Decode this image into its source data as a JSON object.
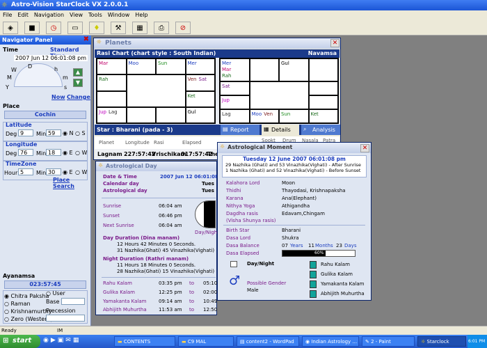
{
  "app": {
    "title": "Astro-Vision StarClock VX 2.0.0.1"
  },
  "menu": [
    "File",
    "Edit",
    "Navigation",
    "View",
    "Tools",
    "Window",
    "Help"
  ],
  "toolbar": [
    "open-icon",
    "save-icon",
    "clock-icon",
    "car-icon",
    "bulb-icon",
    "hammer-icon",
    "map-icon",
    "printer-icon",
    "help-icon"
  ],
  "nav": {
    "title": "Navigator Panel",
    "time_label": "Time",
    "time_mode": "Standard Time",
    "datetime": "2007 Jun 12 06:01:08 pm",
    "dial": {
      "w": "W",
      "d": "D",
      "h": "h",
      "m": "M",
      "mm": "m",
      "y": "Y",
      "s": "s"
    },
    "now": "Now",
    "change": "Change",
    "place_label": "Place",
    "place": "Cochin",
    "latitude_label": "Latitude",
    "lat_deg_label": "Deg",
    "lat_deg": "9",
    "lat_min_label": "Min",
    "lat_min": "59",
    "lat_n": "N",
    "lat_s": "S",
    "longitude_label": "Longitude",
    "lon_deg_label": "Deg",
    "lon_deg": "76",
    "lon_min_label": "Min",
    "lon_min": "18",
    "lon_e": "E",
    "lon_w": "W",
    "timezone_label": "TimeZone",
    "tz_hour_label": "Hour",
    "tz_hour": "5",
    "tz_min_label": "Min",
    "tz_min": "30",
    "tz_e": "E",
    "tz_w": "W",
    "place_search": "Place Search",
    "ayanamsa_label": "Ayanamsa",
    "ayanamsa": "023:57:45",
    "ayanamsa_options": [
      "Chitra Paksha",
      "Raman",
      "Krishnamurthy",
      "Zero (Western)"
    ],
    "user": "User",
    "base": "Base",
    "precession": "Precession"
  },
  "planets": {
    "title": "Planets",
    "rasi_title": "Rasi Chart (chart style : South Indian)",
    "navamsa": "Navamsa",
    "rasi_cells": {
      "c1": [
        "Mar"
      ],
      "c2": [
        "Moo"
      ],
      "c3": [
        "Sun"
      ],
      "c4": [
        "Mer"
      ],
      "c5": [
        "Rah"
      ],
      "c8": [
        "Ven",
        "Sat"
      ],
      "c12": [
        "Ket"
      ],
      "c13": [
        "Jup",
        "Lag"
      ],
      "c16": [
        "Gul"
      ]
    },
    "nav_cells": {
      "c1": [
        "Mer",
        "Mar",
        "Rah"
      ],
      "c3": [
        "Gul"
      ],
      "c5": [
        "Sat"
      ],
      "c9": [
        "Jup"
      ],
      "c13": [
        "Lag"
      ],
      "c14": [
        "Moo",
        "Ven"
      ],
      "c15": [
        "Sun"
      ],
      "c16": [
        "Ket"
      ]
    },
    "star": "Star : Bharani (pada - 3)",
    "tabs": [
      "Report",
      "Details",
      "Analysis"
    ],
    "cols": [
      "Planet",
      "Longitude",
      "Rasi",
      "Elapsed"
    ],
    "row": [
      "Lagnam",
      "227:57:42",
      "Vrischikam",
      "017:57:42",
      "The"
    ],
    "hidden_cols": [
      "Sookt",
      "Drum",
      "Nasala",
      "Patra"
    ]
  },
  "astro_day": {
    "title": "Astrological Day",
    "date_time_label": "Date & Time",
    "date_time": "2007 Jun 12 06:01:08",
    "calendar_label": "Calendar day",
    "calendar": "Tues",
    "astro_label": "Astrological day",
    "astro": "Tues",
    "sunrise_label": "Sunrise",
    "sunrise": "06:04 am",
    "sunset_label": "Sunset",
    "sunset": "06:46 pm",
    "next_sunrise_label": "Next Sunrise",
    "next_sunrise": "06:04 am",
    "daynight": "Day/Nigh",
    "day_dur_label": "Day Duration (Dina manam)",
    "day_dur_1": "12 Hours  42 Minutes  0 Seconds.",
    "day_dur_2": "31 Nazhika(Ghati) 45 Vinazhika(Vighati)",
    "night_dur_label": "Night Duration (Rathri manam)",
    "night_dur_1": "11 Hours  18 Minutes  0 Seconds.",
    "night_dur_2": "28 Nazhika(Ghati) 15 Vinazhika(Vighati)",
    "to": "to",
    "kalams": [
      {
        "name": "Rahu Kalam",
        "from": "03:35 pm",
        "to": "05:10"
      },
      {
        "name": "Gulika Kalam",
        "from": "12:25 pm",
        "to": "02:00"
      },
      {
        "name": "Yamakanta Kalam",
        "from": "09:14 am",
        "to": "10:49"
      },
      {
        "name": "Abhijith Muhurtha",
        "from": "11:53 am",
        "to": "12:50"
      }
    ]
  },
  "moment": {
    "title": "Astrological Moment",
    "date": "Tuesday 12 June 2007   06:01:08 pm",
    "line1": "29 Nazhika (Ghati) and 53 Vinazhika(Vighati) - After Sunrise",
    "line2": "1 Nazhika (Ghati) and 52 Vinazhika(Vighati) - Before Sunset",
    "rows": [
      {
        "label": "Kalahora Lord",
        "value": "Moon"
      },
      {
        "label": "Thidhi",
        "value": "Thayodasi, Krishnapaksha"
      },
      {
        "label": "Karana",
        "value": "Ana(Elephant)"
      },
      {
        "label": "Nithya Yoga",
        "value": "Athigandha"
      },
      {
        "label": "Dagdha rasis",
        "value": "Edavam,Chingam"
      }
    ],
    "dagdha_sub": "(Visha Shunya rasis)",
    "birth_star_label": "Birth Star",
    "birth_star": "Bharani",
    "dasa_lord_label": "Dasa Lord",
    "dasa_lord": "Shukra",
    "dasa_balance_label": "Dasa Balance",
    "years": "07",
    "years_label": "Years",
    "months": "11",
    "months_label": "Months",
    "days": "23",
    "days_label": "Days",
    "dasa_elapsed_label": "Dasa Elapsed",
    "dasa_elapsed": "60%",
    "dasa_elapsed_value": 60,
    "daynight": "Day/Night",
    "gender_label": "Possible Gender",
    "gender": "Male",
    "legend": [
      "Rahu Kalam",
      "Gulika Kalam",
      "Yamakanta Kalam",
      "Abhijith Muhurtha"
    ],
    "legend_color": "#11a39a"
  },
  "status": {
    "ready": "Ready",
    "mode": "IM"
  },
  "taskbar": {
    "start": "start",
    "items": [
      "CONTENTS",
      "C9 MAL",
      "content2 - WordPad",
      "Indian Astrology ...",
      "2 - Paint",
      "Starclock"
    ],
    "clock": "6:01 PM"
  }
}
